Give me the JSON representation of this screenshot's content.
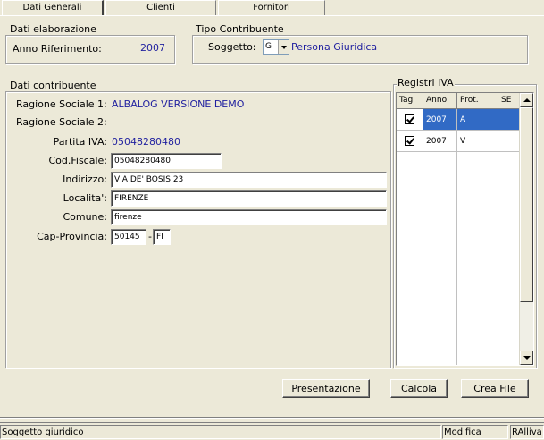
{
  "tabs": [
    {
      "label": "Dati Generali"
    },
    {
      "label": "Clienti"
    },
    {
      "label": "Fornitori"
    }
  ],
  "dati_elaborazione": {
    "title": "Dati elaborazione",
    "anno_label": "Anno Riferimento:",
    "anno_value": "2007"
  },
  "tipo_contribuente": {
    "title": "Tipo Contribuente",
    "soggetto_label": "Soggetto:",
    "soggetto_code": "G",
    "soggetto_desc": "Persona Giuridica"
  },
  "dati_contribuente": {
    "title": "Dati contribuente",
    "ragione1_label": "Ragione Sociale 1:",
    "ragione1_value": "ALBALOG VERSIONE DEMO",
    "ragione2_label": "Ragione Sociale 2:",
    "ragione2_value": "",
    "piva_label": "Partita IVA:",
    "piva_value": "05048280480",
    "codfiscale_label": "Cod.Fiscale:",
    "codfiscale_value": "05048280480",
    "indirizzo_label": "Indirizzo:",
    "indirizzo_value": "VIA DE' BOSIS 23",
    "localita_label": "Localita':",
    "localita_value": "FIRENZE",
    "comune_label": "Comune:",
    "comune_value": "firenze",
    "cap_label": "Cap-Provincia:",
    "cap_value": "50145",
    "cap_sep": "-",
    "provincia_value": "FI"
  },
  "registri": {
    "title": "Registri IVA",
    "columns": [
      "Tag",
      "Anno",
      "Prot.",
      "SE"
    ],
    "rows": [
      {
        "anno": "2007",
        "prot": "A",
        "selected": true
      },
      {
        "anno": "2007",
        "prot": "V",
        "selected": false
      }
    ]
  },
  "buttons": {
    "presentazione": {
      "accel": "P",
      "rest": "resentazione"
    },
    "calcola": {
      "accel": "C",
      "rest": "alcola"
    },
    "crea_file": {
      "pre": "Crea ",
      "accel": "F",
      "rest": "ile"
    }
  },
  "status": {
    "message": "Soggetto giuridico",
    "mode": "Modifica",
    "user": "RAlliva"
  },
  "colors": {
    "selection": "#316ac5",
    "value_blue": "#1f1f9f",
    "background": "#ece9d8"
  }
}
